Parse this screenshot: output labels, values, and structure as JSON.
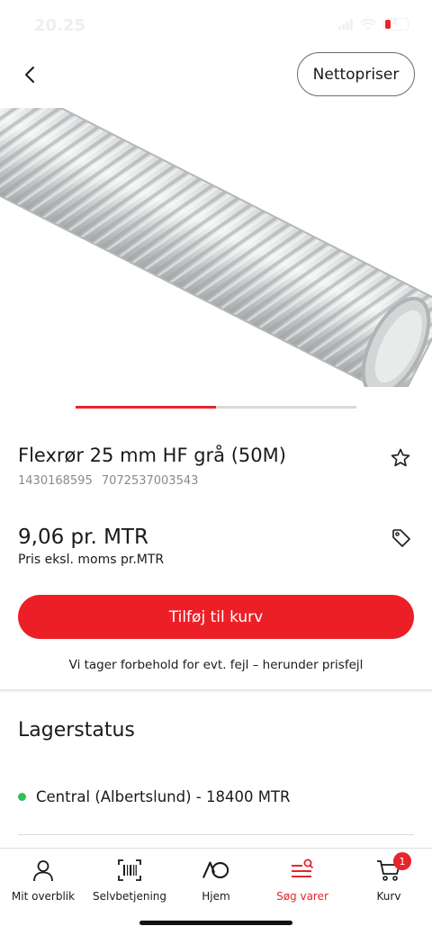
{
  "status_bar": {
    "time": "20.25",
    "battery": "4"
  },
  "header": {
    "netto_label": "Nettopriser"
  },
  "product": {
    "title": "Flexrør 25 mm HF grå (50M)",
    "code_1": "1430168595",
    "code_2": "7072537003543",
    "price": "9,06 pr. MTR",
    "price_note": "Pris eksl. moms pr.MTR",
    "add_to_cart_label": "Tilføj til kurv",
    "disclaimer": "Vi tager forbehold for evt. fejl – herunder prisfejl",
    "carousel": {
      "slides": 2,
      "active": 1
    }
  },
  "stock": {
    "title": "Lagerstatus",
    "locations": [
      {
        "text": "Central (Albertslund) - 18400 MTR",
        "status_color": "#2ec15a"
      }
    ]
  },
  "nav": {
    "items": [
      {
        "label": "Mit overblik",
        "icon": "person-icon"
      },
      {
        "label": "Selvbetjening",
        "icon": "barcode-scan-icon"
      },
      {
        "label": "Hjem",
        "icon": "ao-logo-icon"
      },
      {
        "label": "Søg varer",
        "icon": "search-list-icon",
        "active": true
      },
      {
        "label": "Kurv",
        "icon": "cart-icon",
        "badge": "1"
      }
    ]
  },
  "colors": {
    "accent": "#e8242d",
    "in_stock": "#2ec15a"
  }
}
